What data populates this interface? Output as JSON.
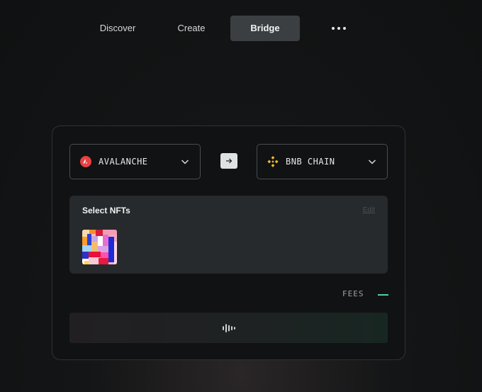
{
  "nav": {
    "items": [
      {
        "label": "Discover"
      },
      {
        "label": "Create"
      },
      {
        "label": "Bridge",
        "active": true
      }
    ],
    "more_icon": "more-horizontal-icon"
  },
  "bridge": {
    "from_chain": {
      "label": "AVALANCHE",
      "icon": "avalanche-icon",
      "color": "#e84142"
    },
    "to_chain": {
      "label": "BNB CHAIN",
      "icon": "bnb-icon",
      "color": "#f3ba2f"
    },
    "swap_icon": "arrow-right-icon",
    "nft_section": {
      "title": "Select NFTs",
      "edit_label": "Edit",
      "selected_count": 1
    },
    "fees": {
      "label": "FEES",
      "value": "—",
      "color": "#4fcfa6"
    },
    "submit": {
      "icon": "loading-waveform-icon"
    }
  }
}
